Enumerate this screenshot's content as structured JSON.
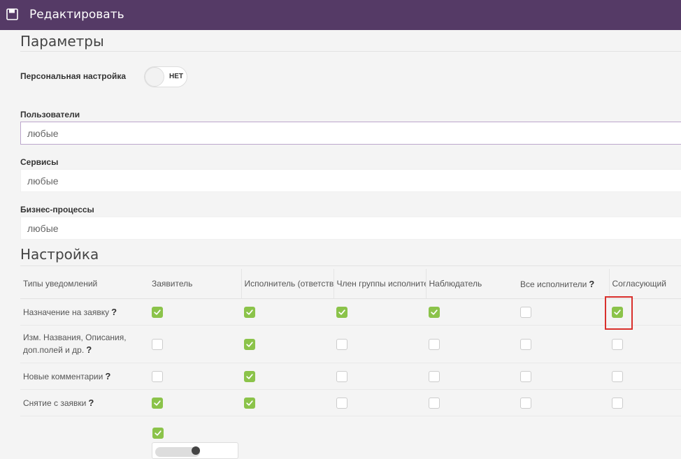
{
  "window": {
    "title": "Редактировать",
    "icon": "save-icon"
  },
  "params": {
    "title": "Параметры",
    "personal": {
      "label": "Персональная настройка",
      "toggle_value": "НЕТ"
    },
    "users": {
      "label": "Пользователи",
      "value": "любые"
    },
    "services": {
      "label": "Сервисы",
      "value": "любые"
    },
    "processes": {
      "label": "Бизнес-процессы",
      "value": "любые"
    }
  },
  "settings": {
    "title": "Настройка",
    "columns": [
      "Типы уведомлений",
      "Заявитель",
      "Исполнитель (ответственный)",
      "Член группы исполнителей",
      "Наблюдатель",
      "Все исполнители",
      "Согласующий"
    ],
    "col5_help": "?",
    "rows": [
      {
        "label": "Назначение на заявку",
        "help": "?",
        "checks": [
          true,
          true,
          true,
          true,
          false,
          true
        ]
      },
      {
        "label": "Изм. Названия, Описания, доп.полей и др.",
        "help": "?",
        "checks": [
          false,
          true,
          false,
          false,
          false,
          false
        ]
      },
      {
        "label": "Новые комментарии",
        "help": "?",
        "checks": [
          false,
          true,
          false,
          false,
          false,
          false
        ]
      },
      {
        "label": "Снятие с заявки",
        "help": "?",
        "checks": [
          true,
          true,
          false,
          false,
          false,
          false
        ]
      }
    ],
    "extra_checkbox": true
  },
  "colors": {
    "titlebar": "#553a66",
    "check": "#8bc34a",
    "highlight": "#d9302c"
  }
}
